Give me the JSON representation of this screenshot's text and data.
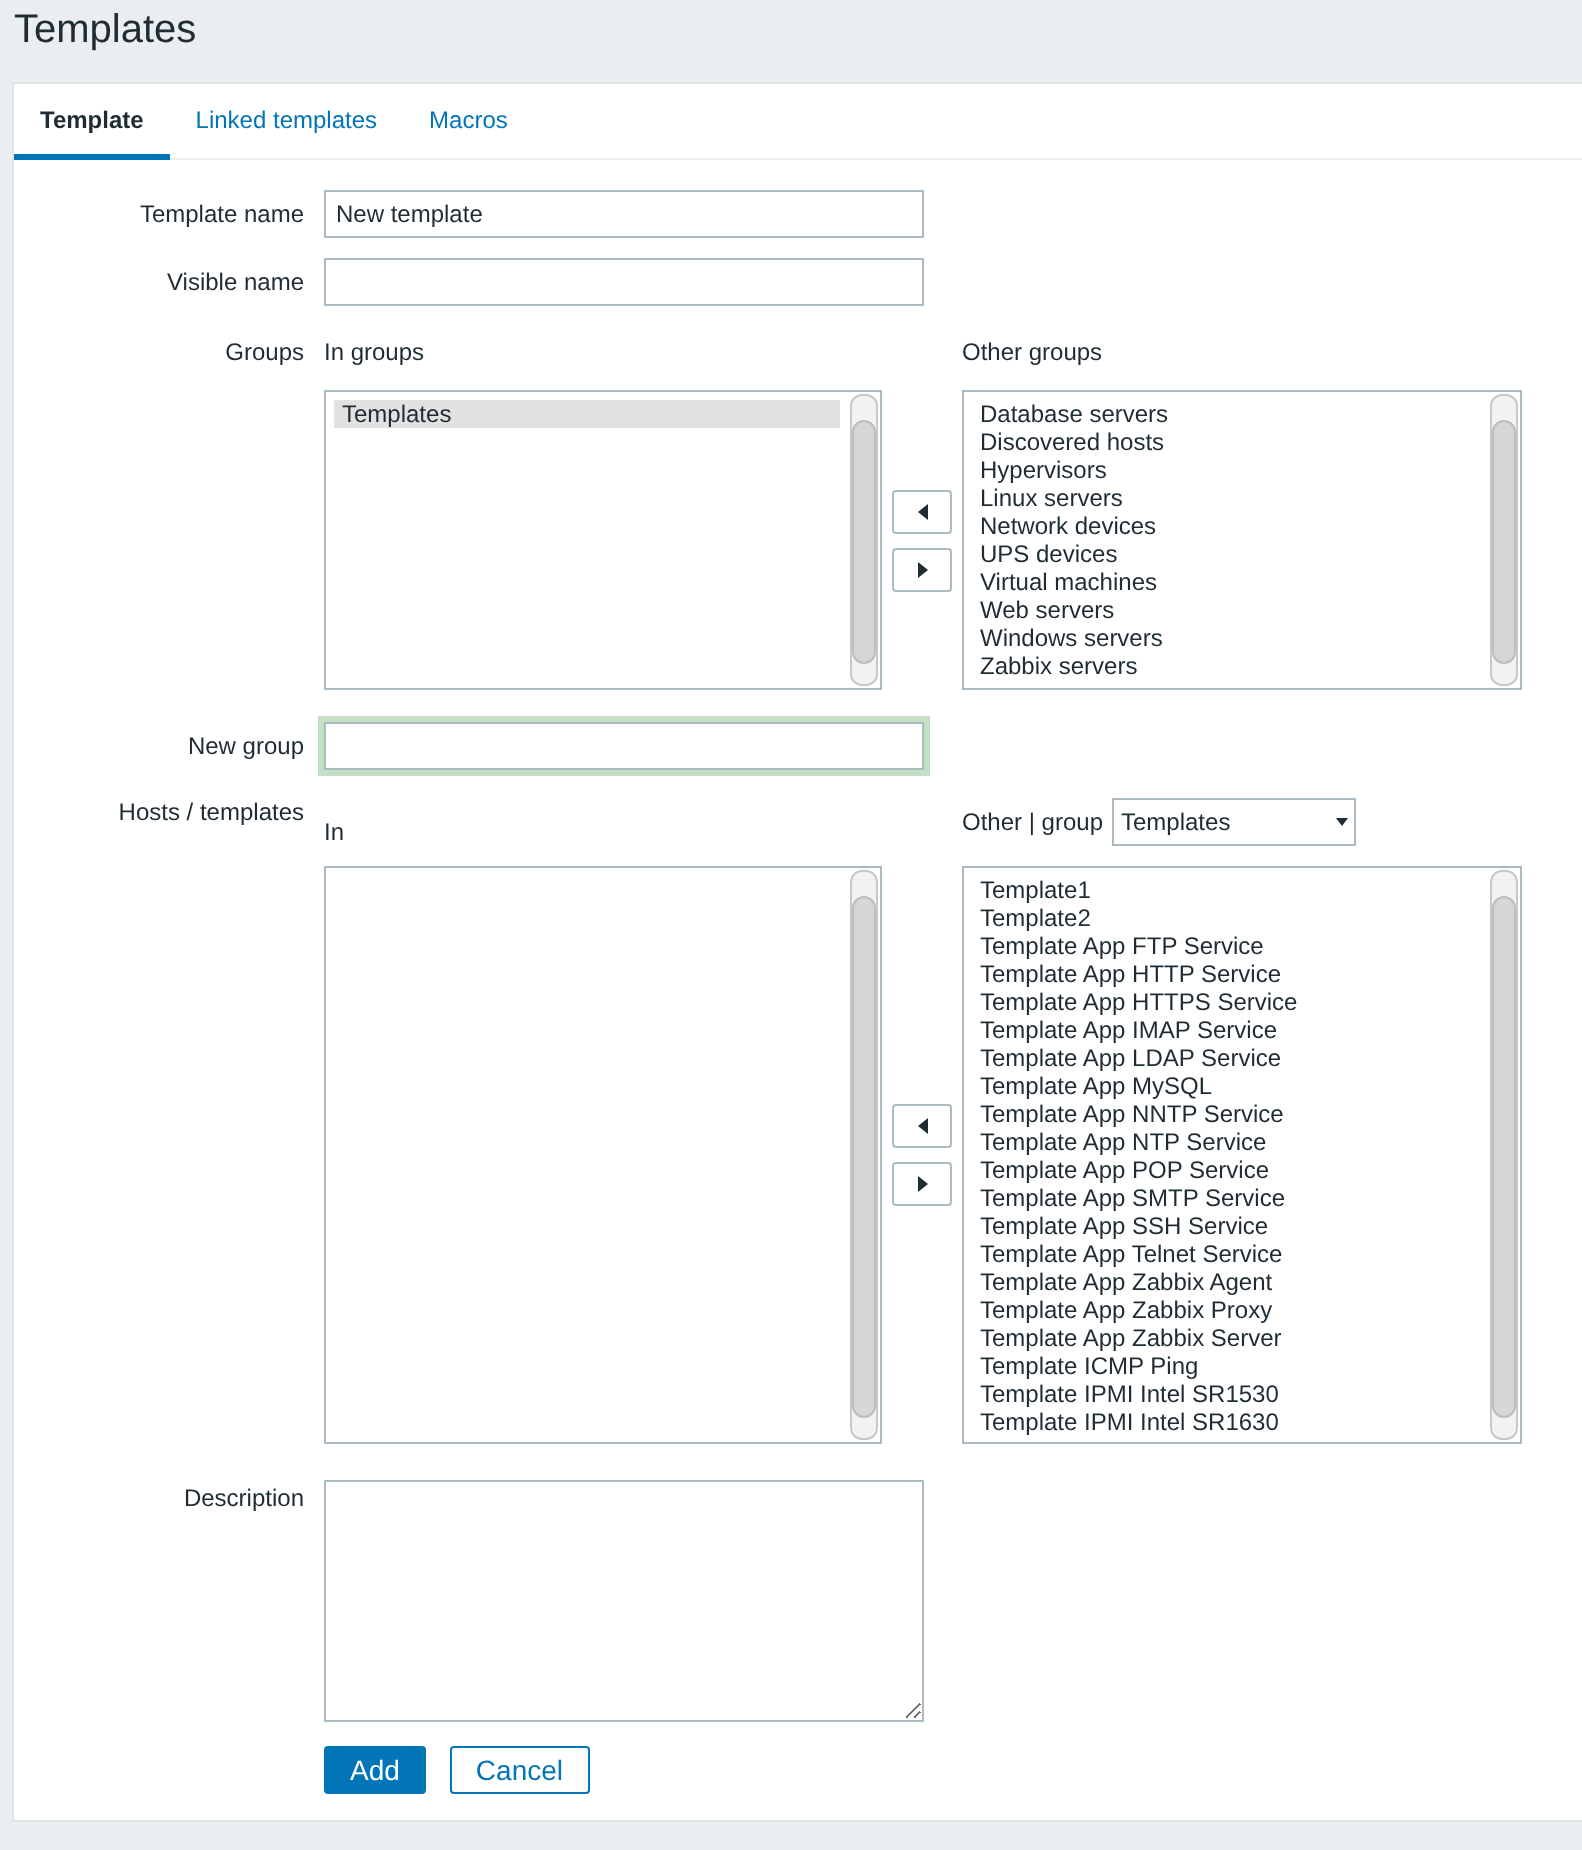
{
  "page_title": "Templates",
  "tabs": [
    {
      "label": "Template",
      "selected": true
    },
    {
      "label": "Linked templates",
      "selected": false
    },
    {
      "label": "Macros",
      "selected": false
    }
  ],
  "form": {
    "template_name": {
      "label": "Template name",
      "value": "New template"
    },
    "visible_name": {
      "label": "Visible name"
    },
    "groups": {
      "label": "Groups",
      "in": {
        "heading": "In groups",
        "items": [
          {
            "label": "Templates",
            "selected": true
          }
        ]
      },
      "other": {
        "heading": "Other groups",
        "items": [
          {
            "label": "Database servers",
            "selected": false
          },
          {
            "label": "Discovered hosts",
            "selected": false
          },
          {
            "label": "Hypervisors",
            "selected": false
          },
          {
            "label": "Linux servers",
            "selected": false
          },
          {
            "label": "Network devices",
            "selected": false
          },
          {
            "label": "UPS devices",
            "selected": false
          },
          {
            "label": "Virtual machines",
            "selected": false
          },
          {
            "label": "Web servers",
            "selected": false
          },
          {
            "label": "Windows servers",
            "selected": false
          },
          {
            "label": "Zabbix servers",
            "selected": false
          }
        ]
      }
    },
    "new_group": {
      "label": "New group",
      "focused": true
    },
    "hosts_templates": {
      "label": "Hosts / templates",
      "in": {
        "heading": "In"
      },
      "other": {
        "heading": "Other | group",
        "group_select": "Templates",
        "items": [
          {
            "label": "Template1",
            "selected": false
          },
          {
            "label": "Template2",
            "selected": false
          },
          {
            "label": "Template App FTP Service",
            "selected": false
          },
          {
            "label": "Template App HTTP Service",
            "selected": false
          },
          {
            "label": "Template App HTTPS Service",
            "selected": false
          },
          {
            "label": "Template App IMAP Service",
            "selected": false
          },
          {
            "label": "Template App LDAP Service",
            "selected": false
          },
          {
            "label": "Template App MySQL",
            "selected": false
          },
          {
            "label": "Template App NNTP Service",
            "selected": false
          },
          {
            "label": "Template App NTP Service",
            "selected": false
          },
          {
            "label": "Template App POP Service",
            "selected": false
          },
          {
            "label": "Template App SMTP Service",
            "selected": false
          },
          {
            "label": "Template App SSH Service",
            "selected": false
          },
          {
            "label": "Template App Telnet Service",
            "selected": false
          },
          {
            "label": "Template App Zabbix Agent",
            "selected": false
          },
          {
            "label": "Template App Zabbix Proxy",
            "selected": false
          },
          {
            "label": "Template App Zabbix Server",
            "selected": false
          },
          {
            "label": "Template ICMP Ping",
            "selected": false
          },
          {
            "label": "Template IPMI Intel SR1530",
            "selected": false
          },
          {
            "label": "Template IPMI Intel SR1630",
            "selected": false
          }
        ]
      }
    },
    "description": {
      "label": "Description"
    },
    "buttons": [
      {
        "label": "Add",
        "kind": "primary"
      },
      {
        "label": "Cancel",
        "kind": "secondary"
      }
    ]
  }
}
